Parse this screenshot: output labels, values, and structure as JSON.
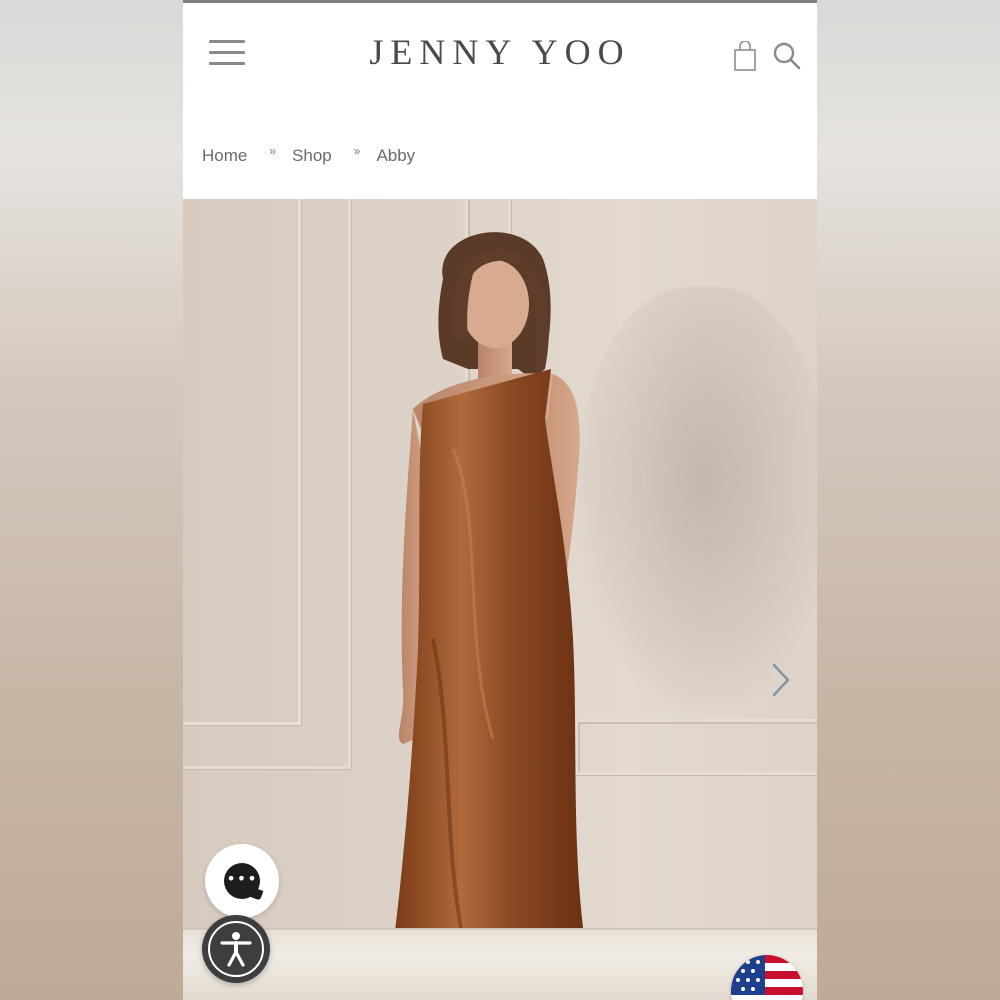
{
  "header": {
    "logo": "JENNY YOO",
    "menu_icon": "hamburger-menu-icon",
    "bag_icon": "shopping-bag-icon",
    "search_icon": "search-icon"
  },
  "breadcrumb": {
    "items": [
      {
        "label": "Home"
      },
      {
        "label": "Shop"
      },
      {
        "label": "Abby"
      }
    ],
    "separator": "»"
  },
  "gallery": {
    "next_icon": "chevron-right-icon"
  },
  "widgets": {
    "chat_label": "•••",
    "chat_icon": "chat-bubble-icon",
    "accessibility_icon": "accessibility-icon",
    "flag_icon": "us-flag-icon"
  },
  "colors": {
    "dress": "#8a4a22",
    "text": "#4a4a4a",
    "accent_dark": "#3e3e3e"
  }
}
